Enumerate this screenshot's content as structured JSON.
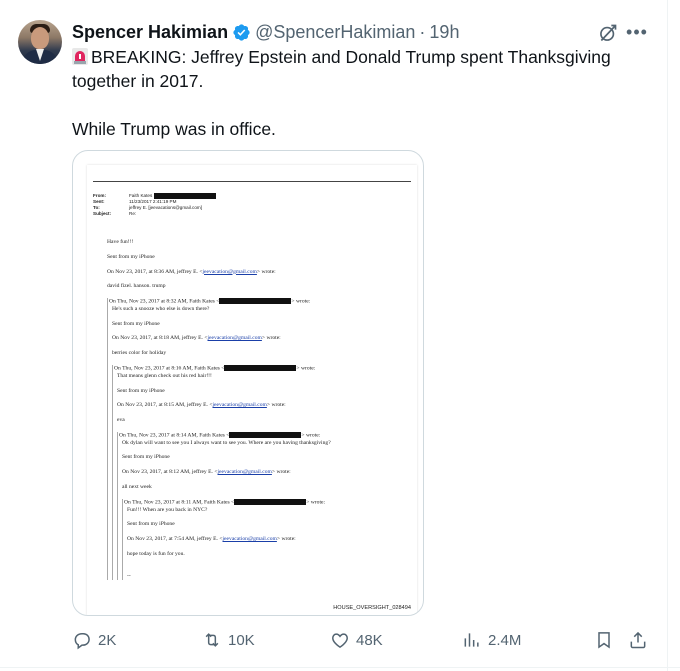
{
  "author": {
    "name": "Spencer Hakimian",
    "handle": "@SpencerHakimian",
    "separator": "·",
    "time": "19h"
  },
  "tweet": {
    "line1": "BREAKING: Jeffrey Epstein and Donald Trump spent Thanksgiving together in 2017.",
    "line2": "While Trump was in office."
  },
  "document": {
    "header": [
      {
        "key": "From:",
        "value": "Faith Kates "
      },
      {
        "key": "Sent:",
        "value": "11/23/2017 2:41:19 PM"
      },
      {
        "key": "To:",
        "value": "jeffrey E. [jeevacations@gmail.com]"
      },
      {
        "key": "Subject:",
        "value": "Re:"
      }
    ],
    "lines": [
      "Have fun!!!",
      "Sent from my iPhone",
      "On Nov 23, 2017, at 8:36 AM, jeffrey E. <",
      "jeevacation@gmail.com",
      "> wrote:",
      "david fizel. hanson. trump",
      "On Thu, Nov 23, 2017 at 8:32 AM, Faith Kates <",
      "> wrote:",
      "He's such a snooze who else is down there?",
      "Sent from my iPhone",
      "On Nov 23, 2017, at 8:18 AM, jeffrey E. <",
      "berries  color for holiday",
      "On Thu, Nov 23, 2017 at 8:16 AM, Faith Kates <",
      "That means glenn check out his red hair!!!",
      "On Nov 23, 2017, at 8:15 AM, jeffrey E. <",
      "eva",
      "On Thu, Nov 23, 2017 at 8:14 AM, Faith Kates <",
      "Ok dylan will want to see you I always want to see you. Where are you having thanksgiving?",
      "On Nov 23, 2017, at 8:12 AM, jeffrey E. <",
      "all next week",
      "On Thu, Nov 23, 2017 at 8:11 AM, Faith Kates <",
      "Fun!!! When are you back in NYC?",
      "On Nov 23, 2017, at 7:54 AM, jeffrey E. <",
      "hope today is fun for you.",
      "--"
    ],
    "footer_id": "HOUSE_OVERSIGHT_028494"
  },
  "actions": {
    "replies": "2K",
    "reposts": "10K",
    "likes": "48K",
    "views": "2.4M"
  },
  "colors": {
    "text": "#0f1419",
    "muted": "#536471",
    "verified": "#1d9bf0",
    "siren": "#e0245e"
  },
  "icons": [
    "verified-badge-icon",
    "grok-icon",
    "more-icon",
    "siren-emoji-icon",
    "reply-icon",
    "repost-icon",
    "like-icon",
    "views-icon",
    "bookmark-icon",
    "share-icon"
  ]
}
